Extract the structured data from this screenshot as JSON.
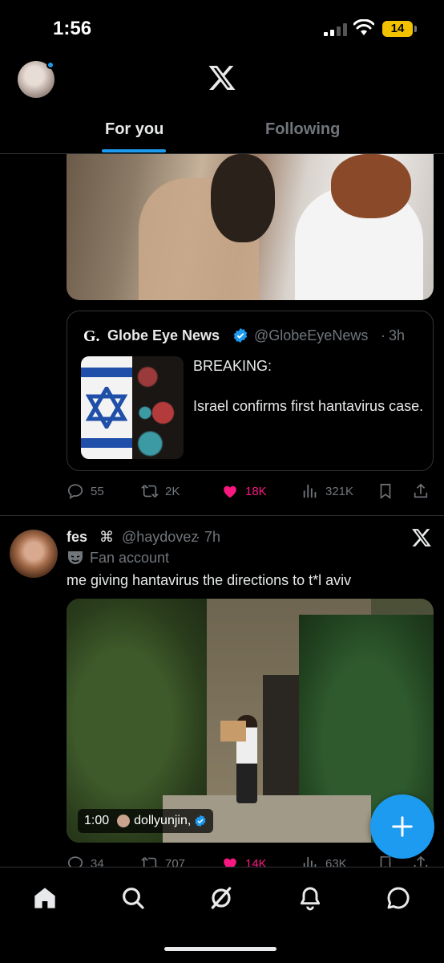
{
  "status_bar": {
    "time": "1:56",
    "battery": "14"
  },
  "header": {
    "tabs": [
      {
        "label": "For you",
        "active": true
      },
      {
        "label": "Following",
        "active": false
      }
    ]
  },
  "post1": {
    "quote": {
      "logo": "G.",
      "name": "Globe Eye News",
      "handle": "@GlobeEyeNews",
      "separator": "·",
      "time": "3h",
      "text": "BREAKING:\n\nIsrael confirms first hantavirus case."
    },
    "actions": {
      "replies": "55",
      "reposts": "2K",
      "likes": "18K",
      "views": "321K"
    }
  },
  "post2": {
    "name": "fes",
    "name_glyph": "⌘",
    "handle": "@haydovez",
    "separator": "·",
    "time": "7h",
    "label": "Fan account",
    "text": "me giving hantavirus the directions to t*l aviv",
    "video": {
      "duration": "1:00",
      "credit": "dollyunjin,"
    },
    "actions": {
      "replies": "34",
      "reposts": "707",
      "likes": "14K",
      "views": "63K"
    }
  },
  "colors": {
    "accent": "#1d9bf0",
    "like": "#f91880",
    "muted": "#71767b",
    "text": "#e7e9ea",
    "battery": "#f2c200"
  },
  "icons": [
    "x-logo-icon",
    "verified-icon",
    "reply-icon",
    "repost-icon",
    "like-icon",
    "views-icon",
    "bookmark-icon",
    "share-icon",
    "fan-mask-icon",
    "compose-plus-icon",
    "home-icon",
    "search-icon",
    "grok-icon",
    "notifications-icon",
    "messages-icon"
  ]
}
